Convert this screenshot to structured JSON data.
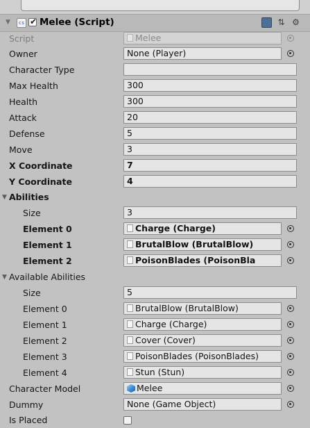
{
  "component": {
    "title": "Melee (Script)",
    "enabled": true,
    "icons": [
      "book-icon",
      "settings-layout-icon",
      "gear-icon"
    ]
  },
  "fields": {
    "script": {
      "label": "Script",
      "value": "Melee"
    },
    "owner": {
      "label": "Owner",
      "value": "None (Player)"
    },
    "character_type": {
      "label": "Character Type",
      "value": ""
    },
    "max_health": {
      "label": "Max Health",
      "value": "300"
    },
    "health": {
      "label": "Health",
      "value": "300"
    },
    "attack": {
      "label": "Attack",
      "value": "20"
    },
    "defense": {
      "label": "Defense",
      "value": "5"
    },
    "move": {
      "label": "Move",
      "value": "3"
    },
    "x_coordinate": {
      "label": "X Coordinate",
      "value": "7"
    },
    "y_coordinate": {
      "label": "Y Coordinate",
      "value": "4"
    }
  },
  "abilities": {
    "label": "Abilities",
    "size_label": "Size",
    "size": "3",
    "elements": [
      {
        "label": "Element 0",
        "value": "Charge (Charge)"
      },
      {
        "label": "Element 1",
        "value": "BrutalBlow (BrutalBlow)"
      },
      {
        "label": "Element 2",
        "value": "PoisonBlades (PoisonBla"
      }
    ]
  },
  "available_abilities": {
    "label": "Available Abilities",
    "size_label": "Size",
    "size": "5",
    "elements": [
      {
        "label": "Element 0",
        "value": "BrutalBlow (BrutalBlow)"
      },
      {
        "label": "Element 1",
        "value": "Charge (Charge)"
      },
      {
        "label": "Element 2",
        "value": "Cover (Cover)"
      },
      {
        "label": "Element 3",
        "value": "PoisonBlades (PoisonBlades)"
      },
      {
        "label": "Element 4",
        "value": "Stun (Stun)"
      }
    ]
  },
  "character_model": {
    "label": "Character Model",
    "value": "Melee"
  },
  "dummy": {
    "label": "Dummy",
    "value": "None (Game Object)"
  },
  "is_placed": {
    "label": "Is Placed",
    "checked": false
  }
}
